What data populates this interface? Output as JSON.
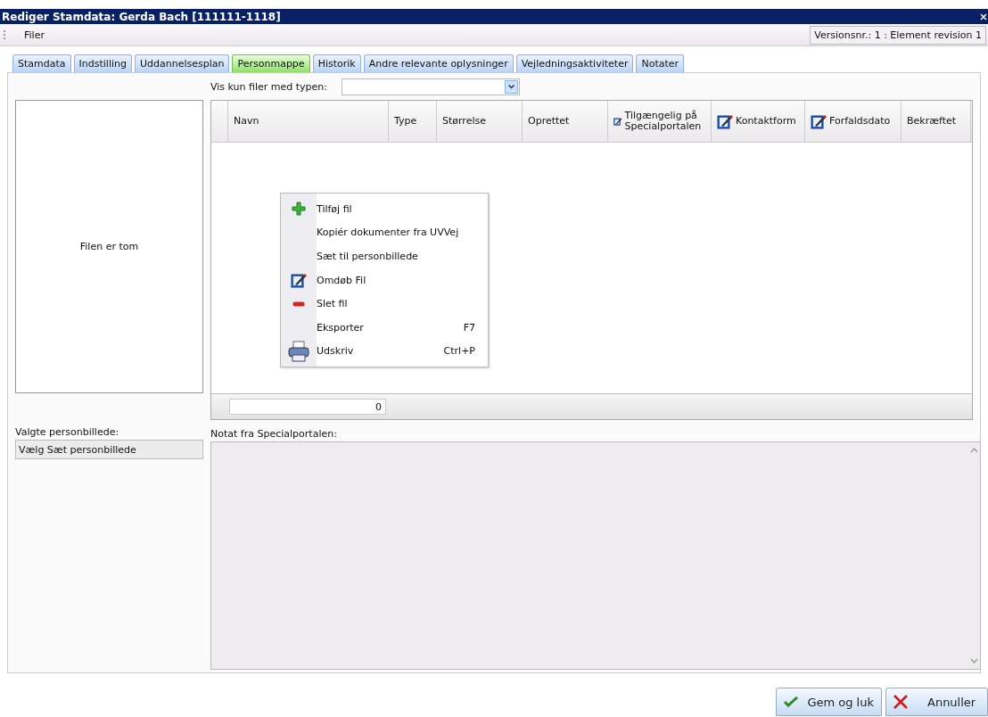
{
  "window": {
    "title": "Rediger Stamdata: Gerda Bach [111111-1118]"
  },
  "menu": [
    "Filer"
  ],
  "version": "Versionsnr.: 1 : Element revision 1",
  "tabs": [
    {
      "label": "Stamdata",
      "selected": false
    },
    {
      "label": "Indstilling",
      "selected": false
    },
    {
      "label": "Uddannelsesplan",
      "selected": false
    },
    {
      "label": "Personmappe",
      "selected": true
    },
    {
      "label": "Historik",
      "selected": false
    },
    {
      "label": "Andre relevante oplysninger",
      "selected": false
    },
    {
      "label": "Vejledningsaktiviteter",
      "selected": false
    },
    {
      "label": "Notater",
      "selected": false
    }
  ],
  "filter": {
    "label": "Vis kun filer med typen:"
  },
  "preview": {
    "text": "Filen er tom"
  },
  "table": {
    "columns": [
      {
        "label": "Navn",
        "kind": "plain"
      },
      {
        "label": "Type",
        "kind": "plain"
      },
      {
        "label": "Størrelse",
        "kind": "plain"
      },
      {
        "label": "Oprettet",
        "kind": "plain"
      },
      {
        "label": "Tilgængelig på Specialportalen",
        "kind": "editable"
      },
      {
        "label": "Kontaktform",
        "kind": "editable"
      },
      {
        "label": "Forfaldsdato",
        "kind": "editable"
      },
      {
        "label": "Bekræftet",
        "kind": "plain"
      }
    ],
    "footer_count": "0"
  },
  "context_menu": [
    {
      "label": "Tilføj fil",
      "kind": "add"
    },
    {
      "label": "Kopiér dokumenter fra UVVej",
      "kind": "plain"
    },
    {
      "label": "Sæt til personbillede",
      "kind": "plain"
    },
    {
      "label": "Omdøb Fil",
      "kind": "edit"
    },
    {
      "label": "Slet fil",
      "kind": "remove"
    },
    {
      "label": "Eksporter",
      "kind": "plain",
      "shortcut": "F7"
    },
    {
      "label": "Udskriv",
      "kind": "print",
      "shortcut": "Ctrl+P"
    }
  ],
  "photo": {
    "label": "Valgte personbillede:",
    "value": "Vælg Sæt personbillede"
  },
  "note": {
    "label": "Notat fra Specialportalen:"
  },
  "buttons": [
    {
      "label": "Gem og luk",
      "kind": "ok"
    },
    {
      "label": "Annuller",
      "kind": "cancel"
    }
  ]
}
